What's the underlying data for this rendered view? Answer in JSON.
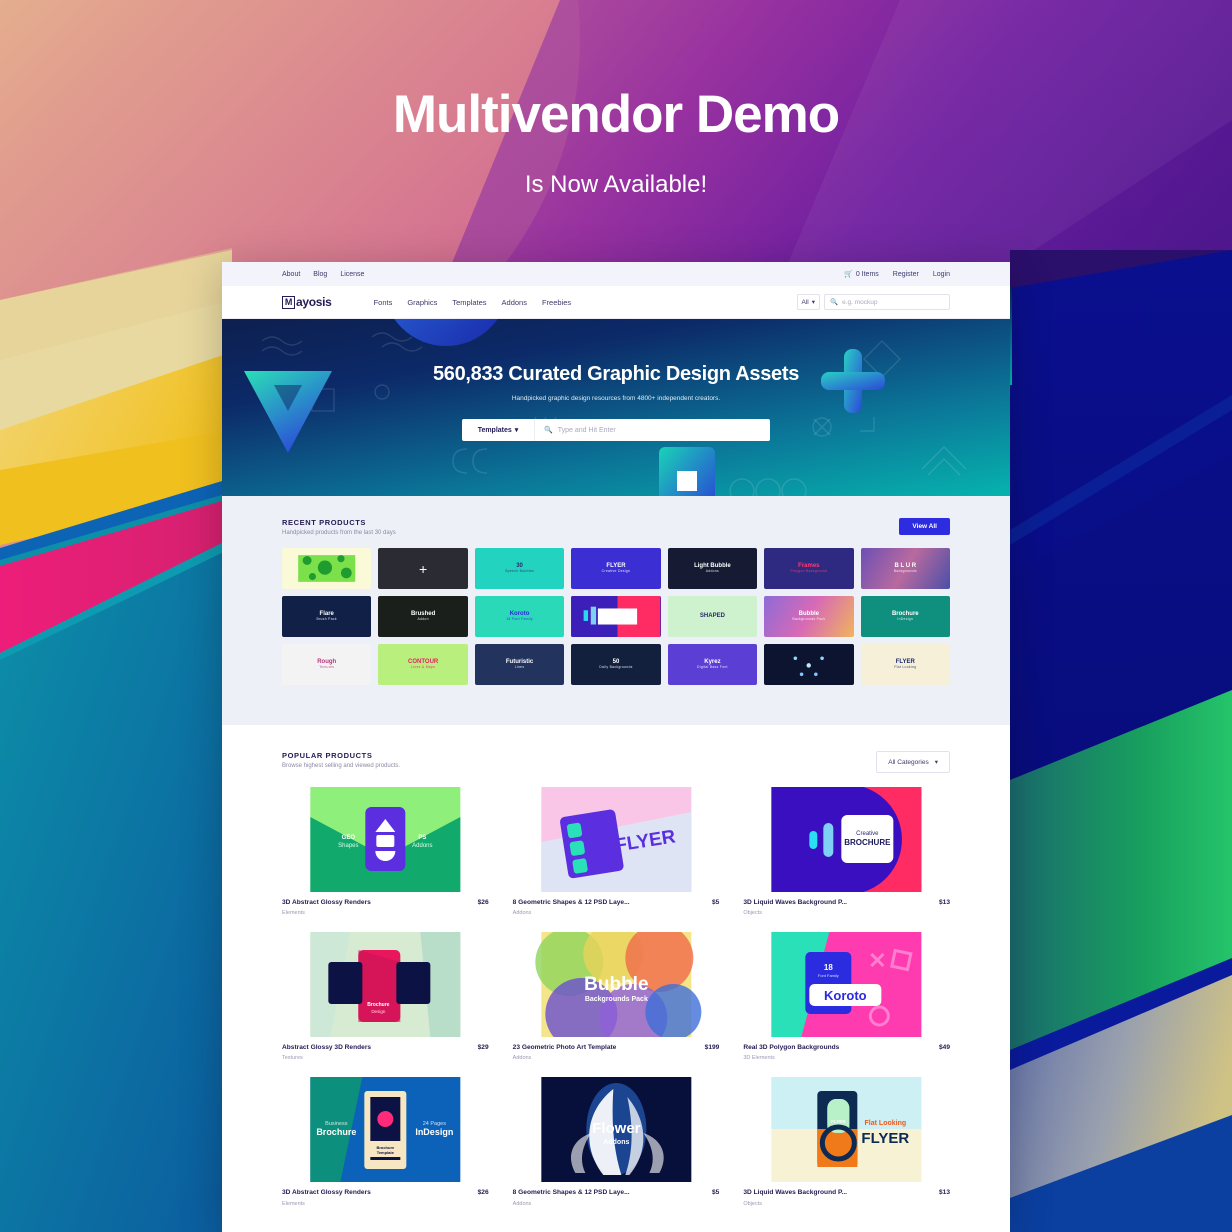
{
  "promo": {
    "title": "Multivendor Demo",
    "subtitle": "Is Now Available!"
  },
  "colors": {
    "accent_blue": "#2d2ce0",
    "dark_navy": "#241c53",
    "hero_teal": "#06b3ae",
    "page_grey": "#eef0f8"
  },
  "site": {
    "topbar": {
      "links": [
        {
          "label": "About"
        },
        {
          "label": "Blog"
        },
        {
          "label": "License"
        }
      ],
      "cart_label": "0 Items",
      "register_label": "Register",
      "login_label": "Login"
    },
    "nav": {
      "logo_letter": "M",
      "logo_rest": "ayosis",
      "links": [
        {
          "label": "Fonts"
        },
        {
          "label": "Graphics"
        },
        {
          "label": "Templates"
        },
        {
          "label": "Addons"
        },
        {
          "label": "Freebies"
        }
      ],
      "category_select": "All",
      "search_placeholder": "e.g. mockup"
    },
    "hero": {
      "headline": "560,833 Curated Graphic Design Assets",
      "subline": "Handpicked graphic design resources from 4800+ independent creators.",
      "search_category": "Templates",
      "search_placeholder": "Type and Hit Enter"
    },
    "recent": {
      "title": "RECENT PRODUCTS",
      "subtitle": "Handpicked products from the last 30 days",
      "view_all": "View All",
      "items": [
        {
          "title": "",
          "sub": "",
          "style": "t-dots"
        },
        {
          "title": "",
          "sub": "",
          "style": "t-plus"
        },
        {
          "title": "30",
          "sub": "Speech Bubbles",
          "style": "t-bubbles30"
        },
        {
          "title": "FLYER",
          "sub": "Creative Design",
          "style": "t-flyerred"
        },
        {
          "title": "Light Bubble",
          "sub": "Addons",
          "style": "t-lightbubble"
        },
        {
          "title": "Frames",
          "sub": "Polygon Background",
          "style": "t-frames"
        },
        {
          "title": "B L U R",
          "sub": "Backgrounds",
          "style": "t-blur"
        },
        {
          "title": "Flare",
          "sub": "Brush Pack",
          "style": "t-flare"
        },
        {
          "title": "Brushed",
          "sub": "Addon",
          "style": "t-brushed"
        },
        {
          "title": "Koroto",
          "sub": "18 Font Family",
          "style": "t-koroto"
        },
        {
          "title": "",
          "sub": "",
          "style": "t-mockupcard"
        },
        {
          "title": "SHAPED",
          "sub": "",
          "style": "t-shaped"
        },
        {
          "title": "Bubble",
          "sub": "Backgrounds Pack",
          "style": "t-bubble"
        },
        {
          "title": "Brochure",
          "sub": "InDesign",
          "style": "t-brochure"
        },
        {
          "title": "Rough",
          "sub": "Textures",
          "style": "t-rough"
        },
        {
          "title": "CONTOUR",
          "sub": "Lines & Maps",
          "style": "t-contour"
        },
        {
          "title": "Futuristic",
          "sub": "Lines",
          "style": "t-futuristic"
        },
        {
          "title": "50",
          "sub": "Daily Backgrounds",
          "style": "t-fifty"
        },
        {
          "title": "Kyrez",
          "sub": "Digital Bass Font",
          "style": "t-kyrez"
        },
        {
          "title": "",
          "sub": "",
          "style": "t-nightdots"
        },
        {
          "title": "FLYER",
          "sub": "Flat Looking",
          "style": "t-flyerorange"
        }
      ]
    },
    "popular": {
      "title": "POPULAR PRODUCTS",
      "subtitle": "Browse highest selling and viewed products.",
      "filter_label": "All Categories",
      "items": [
        {
          "name": "3D Abstract Glossy Renders",
          "category": "Elements",
          "price": "$26",
          "style": "p-geo"
        },
        {
          "name": "8 Geometric Shapes & 12 PSD Laye...",
          "category": "Addons",
          "price": "$5",
          "style": "p-flyer"
        },
        {
          "name": "3D Liquid Waves Background P...",
          "category": "Objects",
          "price": "$13",
          "style": "p-brochure"
        },
        {
          "name": "Abstract Glossy 3D Renders",
          "category": "Textures",
          "price": "$29",
          "style": "p-bookred"
        },
        {
          "name": "23 Geometric Photo Art Template",
          "category": "Addons",
          "price": "$199",
          "style": "p-bubble"
        },
        {
          "name": "Real 3D Polygon Backgrounds",
          "category": "3D Elements",
          "price": "$49",
          "style": "p-koroto"
        },
        {
          "name": "3D Abstract Glossy Renders",
          "category": "Elements",
          "price": "$26",
          "style": "p-indesign"
        },
        {
          "name": "8 Geometric Shapes & 12 PSD Laye...",
          "category": "Addons",
          "price": "$5",
          "style": "p-flower"
        },
        {
          "name": "3D Liquid Waves Background P...",
          "category": "Objects",
          "price": "$13",
          "style": "p-flatflyer"
        }
      ]
    }
  }
}
